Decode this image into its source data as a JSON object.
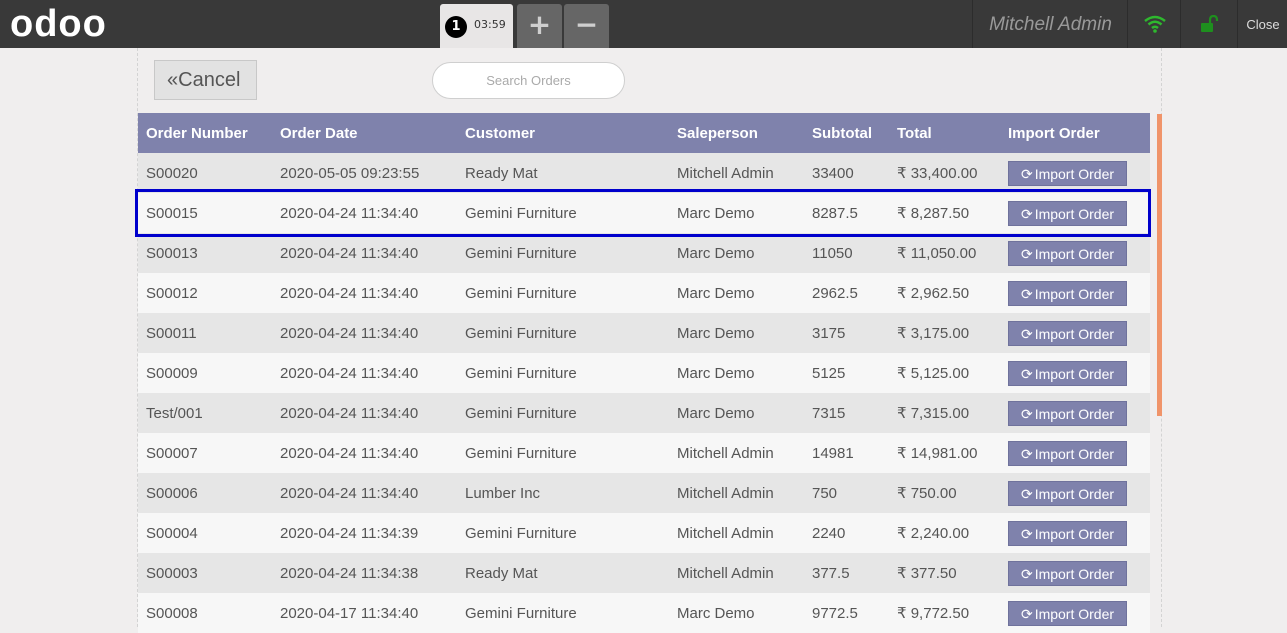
{
  "topbar": {
    "logo": "odoo",
    "order_tab": {
      "number": "1",
      "time": "03:59"
    },
    "add_label": "+",
    "remove_label": "−",
    "user_name": "Mitchell Admin",
    "close_label": "Close",
    "wifi_icon": "wifi-icon",
    "lock_icon": "unlock-icon",
    "status_color": "#2eb82e"
  },
  "toolbar": {
    "cancel_label": "Cancel",
    "search_placeholder": "Search Orders"
  },
  "table": {
    "headers": [
      "Order Number",
      "Order Date",
      "Customer",
      "Saleperson",
      "Subtotal",
      "Total",
      "Import Order"
    ],
    "rows": [
      {
        "order": "S00020",
        "date": "2020-05-05 09:23:55",
        "customer": "Ready Mat",
        "salesperson": "Mitchell Admin",
        "subtotal": "33400",
        "total": "₹ 33,400.00",
        "action": "Import Order"
      },
      {
        "order": "S00015",
        "date": "2020-04-24 11:34:40",
        "customer": "Gemini Furniture",
        "salesperson": "Marc Demo",
        "subtotal": "8287.5",
        "total": "₹ 8,287.50",
        "action": "Import Order"
      },
      {
        "order": "S00013",
        "date": "2020-04-24 11:34:40",
        "customer": "Gemini Furniture",
        "salesperson": "Marc Demo",
        "subtotal": "11050",
        "total": "₹ 11,050.00",
        "action": "Import Order"
      },
      {
        "order": "S00012",
        "date": "2020-04-24 11:34:40",
        "customer": "Gemini Furniture",
        "salesperson": "Marc Demo",
        "subtotal": "2962.5",
        "total": "₹ 2,962.50",
        "action": "Import Order"
      },
      {
        "order": "S00011",
        "date": "2020-04-24 11:34:40",
        "customer": "Gemini Furniture",
        "salesperson": "Marc Demo",
        "subtotal": "3175",
        "total": "₹ 3,175.00",
        "action": "Import Order"
      },
      {
        "order": "S00009",
        "date": "2020-04-24 11:34:40",
        "customer": "Gemini Furniture",
        "salesperson": "Marc Demo",
        "subtotal": "5125",
        "total": "₹ 5,125.00",
        "action": "Import Order"
      },
      {
        "order": "Test/001",
        "date": "2020-04-24 11:34:40",
        "customer": "Gemini Furniture",
        "salesperson": "Marc Demo",
        "subtotal": "7315",
        "total": "₹ 7,315.00",
        "action": "Import Order"
      },
      {
        "order": "S00007",
        "date": "2020-04-24 11:34:40",
        "customer": "Gemini Furniture",
        "salesperson": "Mitchell Admin",
        "subtotal": "14981",
        "total": "₹ 14,981.00",
        "action": "Import Order"
      },
      {
        "order": "S00006",
        "date": "2020-04-24 11:34:40",
        "customer": "Lumber Inc",
        "salesperson": "Mitchell Admin",
        "subtotal": "750",
        "total": "₹ 750.00",
        "action": "Import Order"
      },
      {
        "order": "S00004",
        "date": "2020-04-24 11:34:39",
        "customer": "Gemini Furniture",
        "salesperson": "Mitchell Admin",
        "subtotal": "2240",
        "total": "₹ 2,240.00",
        "action": "Import Order"
      },
      {
        "order": "S00003",
        "date": "2020-04-24 11:34:38",
        "customer": "Ready Mat",
        "salesperson": "Mitchell Admin",
        "subtotal": "377.5",
        "total": "₹ 377.50",
        "action": "Import Order"
      },
      {
        "order": "S00008",
        "date": "2020-04-17 11:34:40",
        "customer": "Gemini Furniture",
        "salesperson": "Marc Demo",
        "subtotal": "9772.5",
        "total": "₹ 9,772.50",
        "action": "Import Order"
      }
    ]
  }
}
